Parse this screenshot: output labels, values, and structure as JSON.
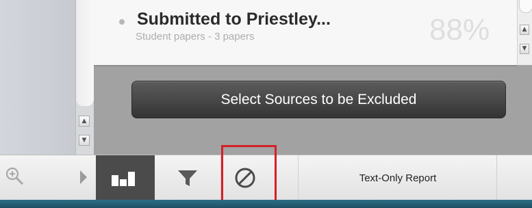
{
  "match": {
    "title": "Submitted to Priestley...",
    "subtitle": "Student papers - 3 papers",
    "percent": "88%"
  },
  "exclude_button": {
    "label": "Select Sources to be Excluded"
  },
  "toolbar": {
    "items": [
      {
        "name": "zoom",
        "icon": "zoom-in-icon"
      },
      {
        "name": "expand",
        "icon": "chevron-right-icon"
      },
      {
        "name": "match-overview",
        "icon": "bar-chart-icon",
        "active": true
      },
      {
        "name": "filters",
        "icon": "filter-icon"
      },
      {
        "name": "exclude",
        "icon": "no-entry-icon",
        "highlighted": true
      }
    ],
    "text_only_label": "Text-Only Report"
  },
  "colors": {
    "highlight": "#d51f26",
    "active_tab": "#4b4b4b",
    "button_dark": "#3a3a3a",
    "taskbar": "#2d6f86"
  }
}
